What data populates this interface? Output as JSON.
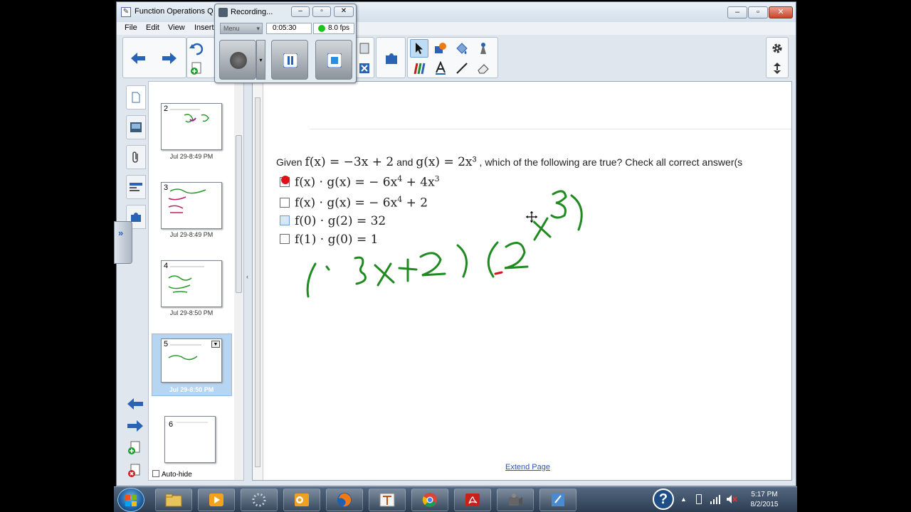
{
  "window": {
    "title": "Function Operations Q",
    "min_label": "–",
    "max_label": "▫",
    "close_label": "✕"
  },
  "menu": {
    "file": "File",
    "edit": "Edit",
    "view": "View",
    "insert": "Insert"
  },
  "recorder": {
    "title": "Recording...",
    "menu_label": "Menu",
    "elapsed": "0:05:30",
    "fps": "8.0 fps",
    "fps_status_color": "#1ec41e",
    "min_label": "–",
    "max_label": "▫",
    "close_label": "✕"
  },
  "sorter": {
    "pages": [
      {
        "number": "2",
        "timestamp": "Jul 29-8:49 PM"
      },
      {
        "number": "3",
        "timestamp": "Jul 29-8:49 PM"
      },
      {
        "number": "4",
        "timestamp": "Jul 29-8:50 PM"
      },
      {
        "number": "5",
        "timestamp": "Jul 29-8:50 PM",
        "selected": true
      },
      {
        "number": "6",
        "timestamp": ""
      }
    ],
    "autohide_label": "Auto-hide"
  },
  "page": {
    "question_prefix": "Given",
    "question_f": "f(x) = −3x + 2",
    "question_and": "and",
    "question_g": "g(x) = 2x",
    "question_g_exp": "3",
    "question_suffix": ", which of the following are true? Check all correct answer(s",
    "options": [
      {
        "text": "f(x) · g(x) = − 6x",
        "exp1": "4",
        "mid": " + 4x",
        "exp2": "3",
        "checked_mark": true
      },
      {
        "text": "f(x) · g(x) = − 6x",
        "exp1": "4",
        "mid": " + 2",
        "exp2": ""
      },
      {
        "text": "f(0) · g(2) = 32",
        "exp1": "",
        "mid": "",
        "exp2": ""
      },
      {
        "text": "f(1) · g(0) = 1",
        "exp1": "",
        "mid": "",
        "exp2": ""
      }
    ],
    "handwriting_color": "#1f8a1f",
    "extend_label": "Extend Page"
  },
  "taskbar": {
    "time": "5:17 PM",
    "date": "8/2/2015",
    "help_label": "?"
  }
}
